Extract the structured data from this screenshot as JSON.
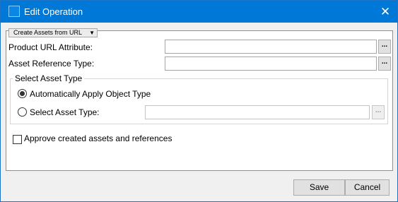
{
  "dialog": {
    "title": "Edit Operation",
    "close_symbol": "✕"
  },
  "section": {
    "selected": "Create Assets from URL",
    "caret": "▼"
  },
  "fields": {
    "product_url_attribute": {
      "label": "Product URL Attribute:",
      "value": "",
      "browse": "..."
    },
    "asset_reference_type": {
      "label": "Asset Reference Type:",
      "value": "",
      "browse": "..."
    }
  },
  "asset_type_group": {
    "legend": "Select Asset Type",
    "options": [
      {
        "label": "Automatically Apply Object Type",
        "checked": true
      },
      {
        "label": "Select Asset Type:",
        "checked": false
      }
    ],
    "select_value": "",
    "browse": "..."
  },
  "approve": {
    "label": "Approve created assets and references",
    "checked": false
  },
  "buttons": {
    "save": "Save",
    "cancel": "Cancel"
  },
  "colors": {
    "titlebar": "#0078d7",
    "dialog_bg": "#f0f0f0"
  }
}
